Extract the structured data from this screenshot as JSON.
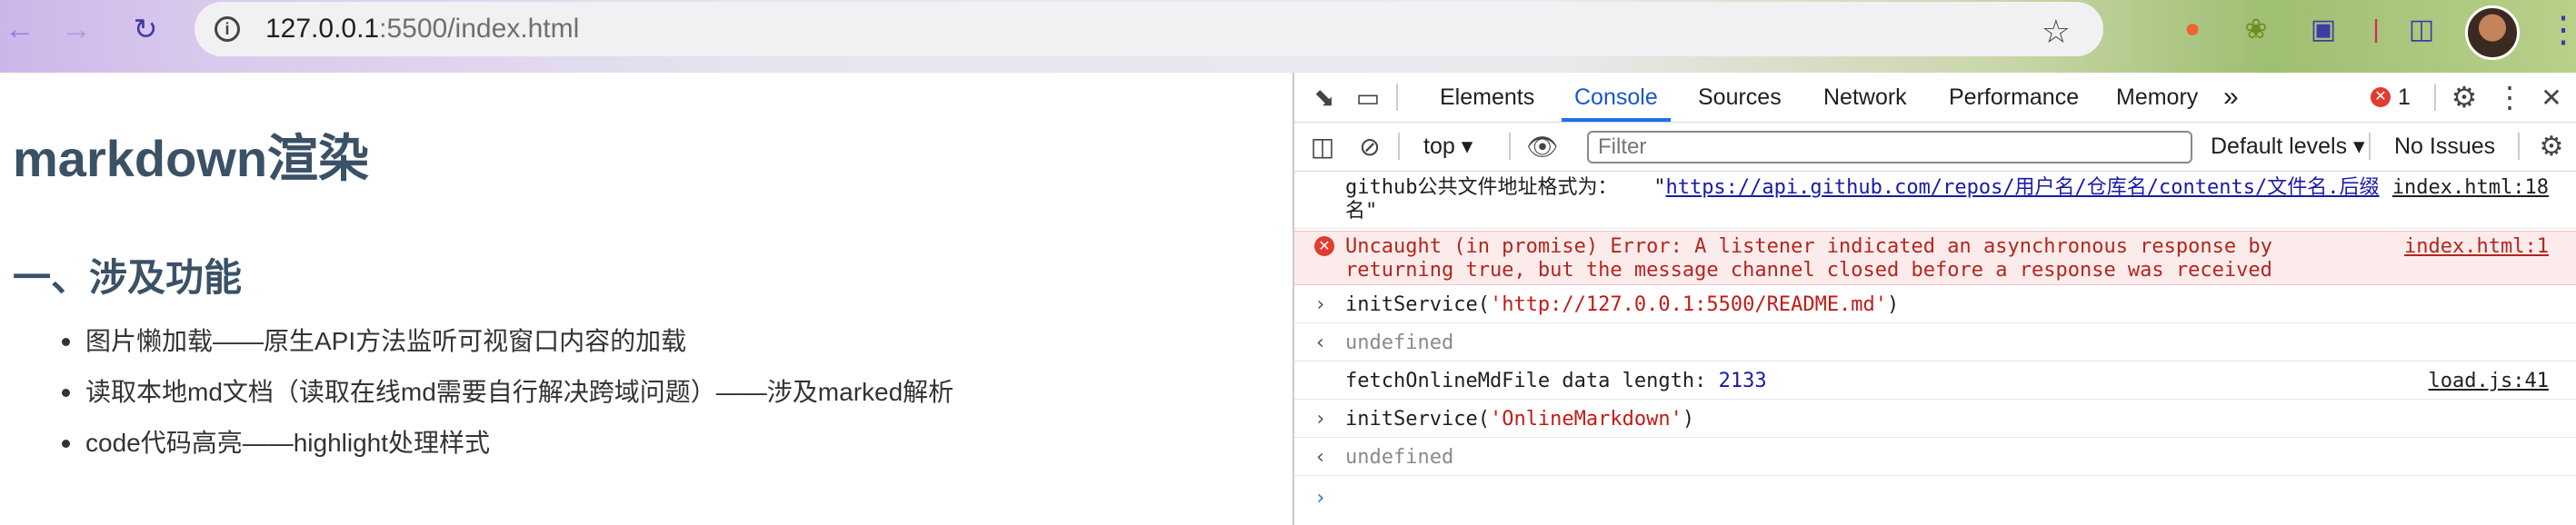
{
  "browser": {
    "url_host": "127.0.0.1",
    "url_rest": ":5500/index.html"
  },
  "page": {
    "title": "markdown渲染",
    "section_title": "一、涉及功能",
    "features": [
      "图片懒加载——原生API方法监听可视窗口内容的加载",
      "读取本地md文档（读取在线md需要自行解决跨域问题）——涉及marked解析",
      "code代码高亮——highlight处理样式"
    ]
  },
  "devtools": {
    "tabs": [
      "Elements",
      "Console",
      "Sources",
      "Network",
      "Performance",
      "Memory"
    ],
    "active_tab": "Console",
    "more_tabs": "»",
    "error_count": "1",
    "context": "top",
    "filter_placeholder": "Filter",
    "levels": "Default levels",
    "issues": "No Issues",
    "console": {
      "log1_text": "github公共文件地址格式为：   \"",
      "log1_link": "https://api.github.com/repos/用户名/仓库名/contents/文件名.后缀",
      "log1_tail": "名\"",
      "log1_src": "index.html:18",
      "error_line1": "Uncaught (in promise) Error: A listener indicated an asynchronous response by",
      "error_line2": "returning true, but the message channel closed before a response was received",
      "error_src": "index.html:1",
      "cmd1_fn": "initService(",
      "cmd1_arg": "'http://127.0.0.1:5500/README.md'",
      "cmd_close": ")",
      "result1": "undefined",
      "log2_text": "fetchOnlineMdFile data length: ",
      "log2_num": "2133",
      "log2_src": "load.js:41",
      "cmd2_fn": "initService(",
      "cmd2_arg": "'OnlineMarkdown'",
      "result2": "undefined"
    }
  },
  "colors": {
    "accent": "#1a73e8",
    "heading": "#3a5166",
    "error_bg": "#fcebeb",
    "error_text": "#b3261e",
    "string": "#c41a16"
  }
}
